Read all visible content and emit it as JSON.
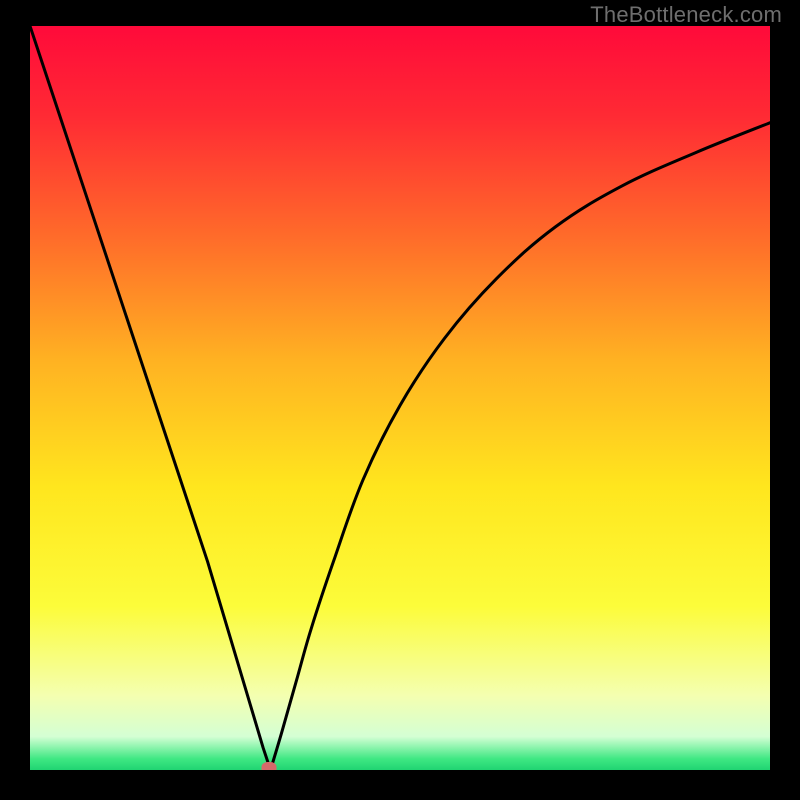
{
  "watermark": "TheBottleneck.com",
  "chart_data": {
    "type": "line",
    "title": "",
    "xlabel": "",
    "ylabel": "",
    "xlim": [
      0,
      100
    ],
    "ylim": [
      0,
      100
    ],
    "gradient_stops": [
      {
        "offset": 0.0,
        "color": "#ff0a3a"
      },
      {
        "offset": 0.12,
        "color": "#ff2a34"
      },
      {
        "offset": 0.28,
        "color": "#ff6a2a"
      },
      {
        "offset": 0.45,
        "color": "#ffb222"
      },
      {
        "offset": 0.62,
        "color": "#ffe61e"
      },
      {
        "offset": 0.78,
        "color": "#fcfc3a"
      },
      {
        "offset": 0.9,
        "color": "#f4ffb0"
      },
      {
        "offset": 0.955,
        "color": "#d4ffd4"
      },
      {
        "offset": 0.985,
        "color": "#3fe883"
      },
      {
        "offset": 1.0,
        "color": "#20d472"
      }
    ],
    "series": [
      {
        "name": "left-branch",
        "x": [
          0,
          4,
          8,
          12,
          16,
          20,
          24,
          27,
          30,
          31.5,
          32.5
        ],
        "values": [
          100,
          88,
          76,
          64,
          52,
          40,
          28,
          18,
          8,
          3,
          0
        ]
      },
      {
        "name": "right-branch",
        "x": [
          32.5,
          34,
          36,
          38,
          41,
          45,
          50,
          56,
          63,
          71,
          80,
          90,
          100
        ],
        "values": [
          0,
          5,
          12,
          19,
          28,
          39,
          49,
          58,
          66,
          73,
          78.5,
          83,
          87
        ]
      }
    ],
    "marker": {
      "x": 32.3,
      "y": 0.3,
      "color": "#d46a6a"
    }
  }
}
